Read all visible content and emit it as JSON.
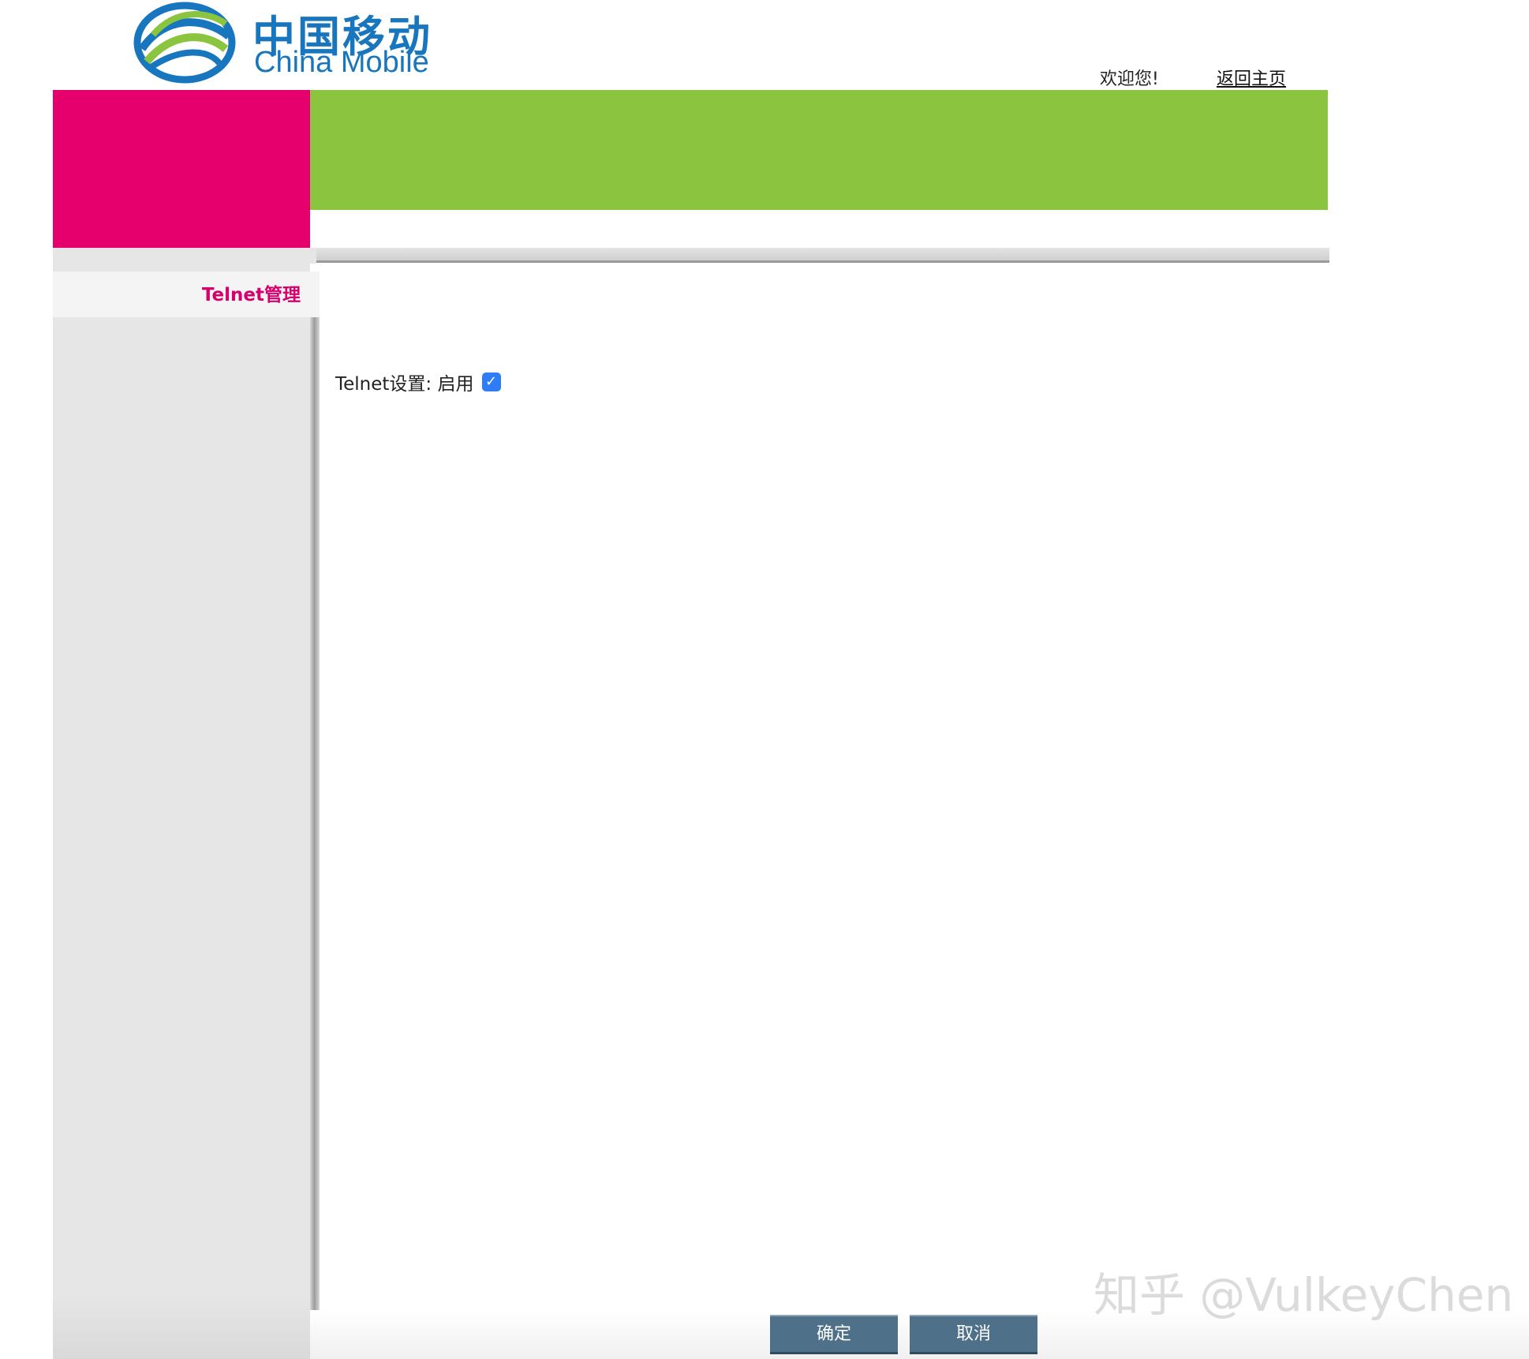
{
  "header": {
    "logo_cn": "中国移动",
    "logo_en": "China Mobile",
    "welcome": "欢迎您!",
    "home_link": "返回主页"
  },
  "sidebar": {
    "items": [
      {
        "label": "Telnet管理"
      }
    ]
  },
  "main": {
    "setting_label": "Telnet设置: 启用",
    "telnet_enabled": true
  },
  "buttons": {
    "ok": "确定",
    "cancel": "取消"
  },
  "watermark": "知乎 @VulkeyChen",
  "colors": {
    "brand_blue": "#1776bd",
    "magenta": "#e5006d",
    "green": "#8bc43f",
    "sidebar_text": "#d6006c",
    "button": "#4e7088",
    "checkbox": "#2f7df6"
  }
}
